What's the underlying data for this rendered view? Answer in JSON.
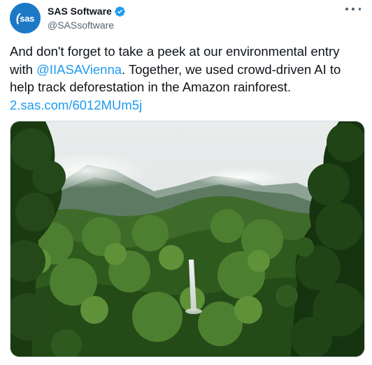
{
  "author": {
    "display_name": "SAS Software",
    "handle": "@SASsoftware",
    "avatar_text": "sas",
    "verified": true
  },
  "tweet": {
    "text_before_mention": "And don't forget to take a peek at our environmental entry with ",
    "mention": "@IIASAVienna",
    "text_after_mention": ". Together, we used crowd-driven AI to help track deforestation in the Amazon rainforest. ",
    "link": "2.sas.com/6012MUm5j"
  },
  "media": {
    "image_description": "rainforest-waterfall-photo"
  },
  "colors": {
    "brand_blue": "#1d78c6",
    "link_blue": "#1d9bf0",
    "text": "#0f1419",
    "secondary_text": "#536471"
  },
  "icons": {
    "verified": "verified-badge-icon",
    "more": "more-options-icon"
  }
}
